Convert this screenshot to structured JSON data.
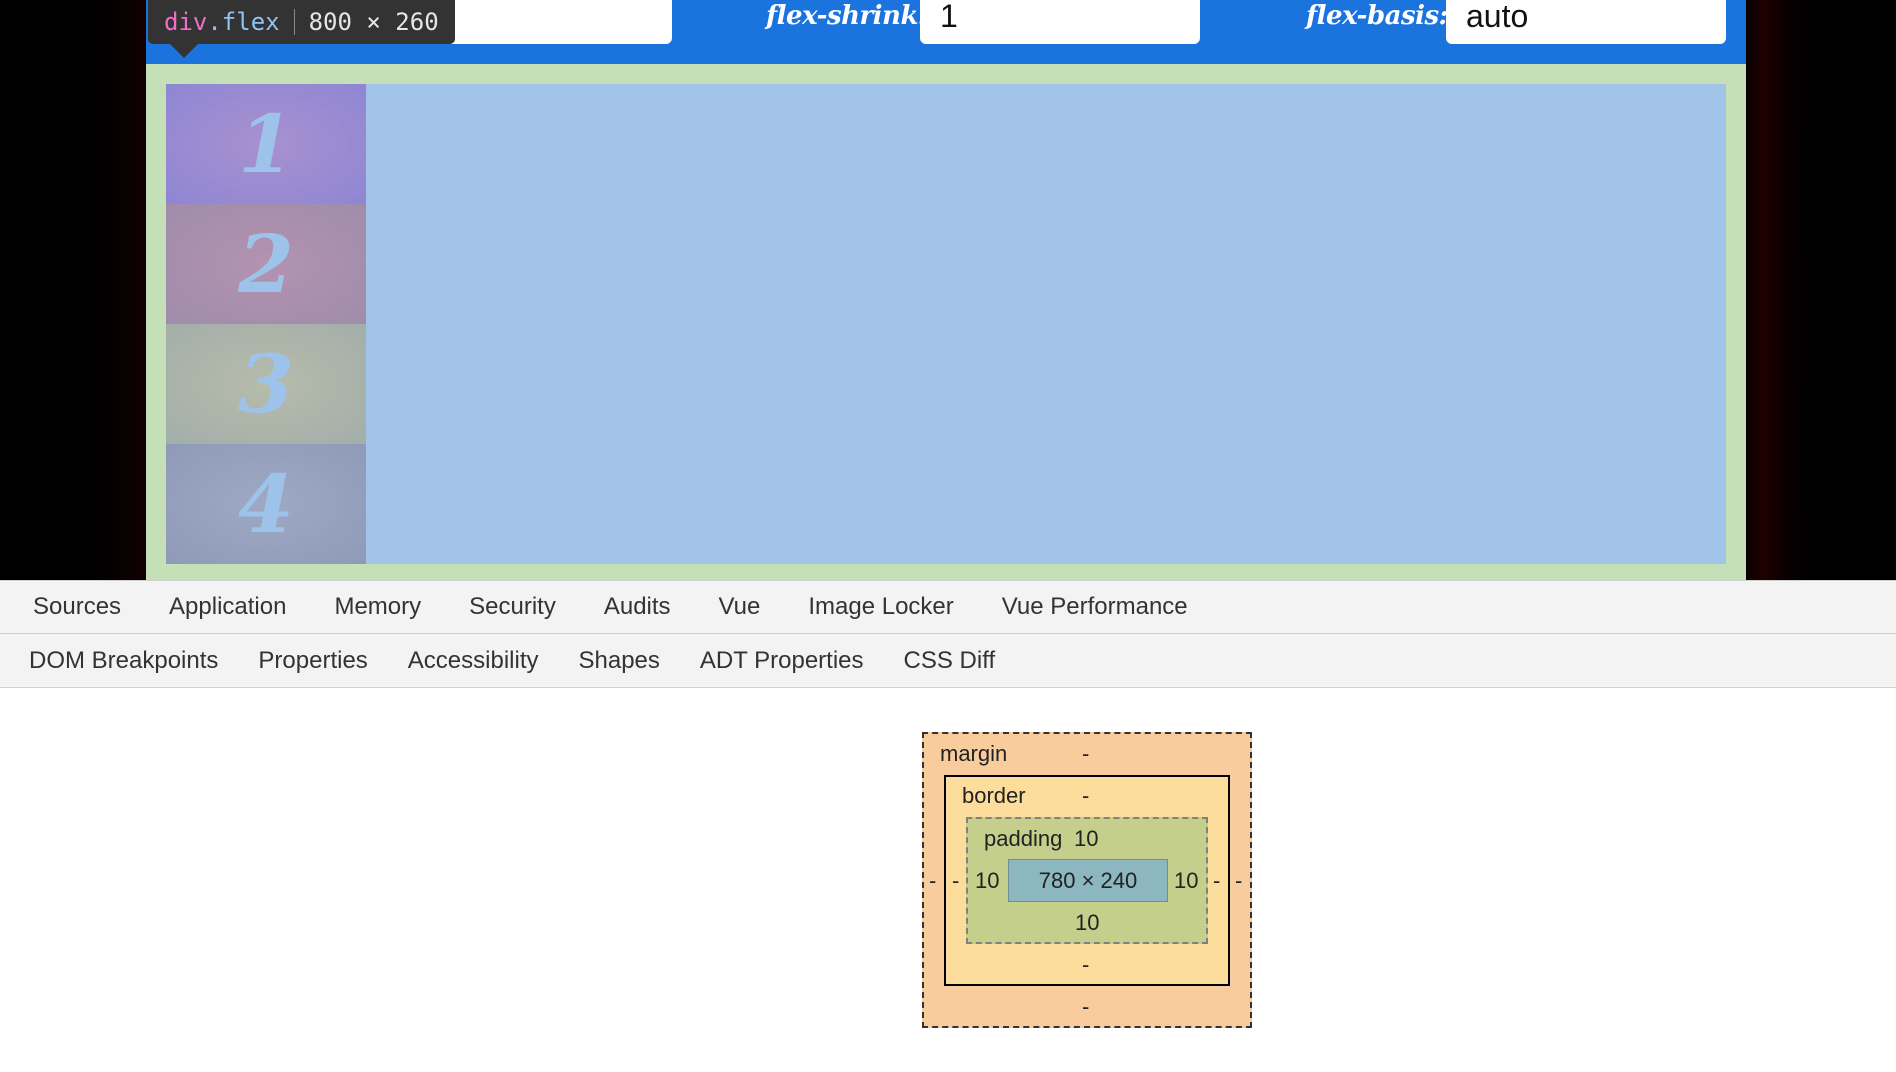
{
  "page": {
    "controls": {
      "flex_shrink_label": "flex-shrink:",
      "flex_shrink_value": "1",
      "flex_basis_label": "flex-basis:",
      "flex_basis_value": "auto"
    },
    "tooltip": {
      "tag": "div",
      "class": ".flex",
      "size": "800 × 260"
    },
    "flex_items": [
      "1",
      "2",
      "3",
      "4"
    ],
    "colors": {
      "controls_bar": "#1b74dd",
      "page_background": "#c5dfb7",
      "flex_container": "#a1c4e8"
    }
  },
  "devtools": {
    "main_tabs": [
      "Sources",
      "Application",
      "Memory",
      "Security",
      "Audits",
      "Vue",
      "Image Locker",
      "Vue Performance"
    ],
    "sidebar_tabs": [
      "DOM Breakpoints",
      "Properties",
      "Accessibility",
      "Shapes",
      "ADT Properties",
      "CSS Diff"
    ],
    "box_model": {
      "margin_label": "margin",
      "margin_top": "-",
      "margin_right": "-",
      "margin_bottom": "-",
      "margin_left": "-",
      "border_label": "border",
      "border_top": "-",
      "border_right": "-",
      "border_bottom": "-",
      "border_left": "-",
      "padding_label": "padding",
      "padding_top": "10",
      "padding_right": "10",
      "padding_bottom": "10",
      "padding_left": "10",
      "content_size": "780 × 240"
    }
  }
}
